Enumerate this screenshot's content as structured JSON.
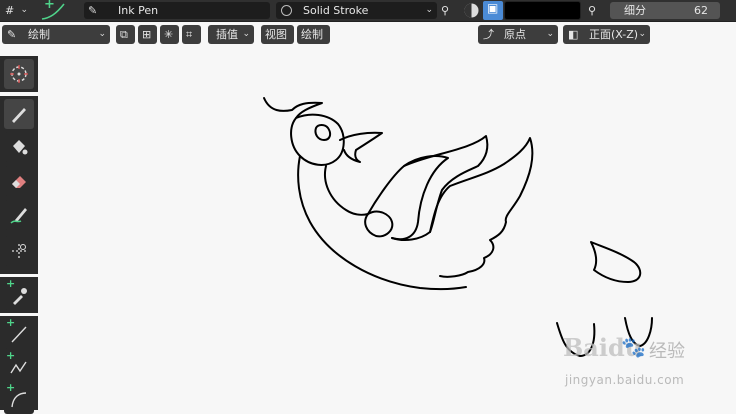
{
  "header": {
    "brush_name": "Ink Pen",
    "material_name": "Solid Stroke",
    "subdivision_label": "细分",
    "subdivision_value": "62"
  },
  "toolbar": {
    "mode": "绘制",
    "interpolate": "插值",
    "view": "视图",
    "draw": "绘制",
    "origin": "原点",
    "orientation": "正面(X-Z)"
  },
  "tools": [
    {
      "name": "cursor"
    },
    {
      "name": "draw"
    },
    {
      "name": "fill"
    },
    {
      "name": "erase"
    },
    {
      "name": "tint"
    },
    {
      "name": "cutter"
    },
    {
      "name": "eyedropper"
    },
    {
      "name": "line"
    },
    {
      "name": "polyline"
    },
    {
      "name": "arc"
    }
  ],
  "watermark": {
    "brand": "Baidu",
    "label": "经验",
    "url": "jingyan.baidu.com"
  },
  "colors": {
    "accent": "#4b8bd6",
    "header_bg": "#303030",
    "canvas_bg": "#f7f7f7",
    "tool_plus": "#4fd38a"
  }
}
